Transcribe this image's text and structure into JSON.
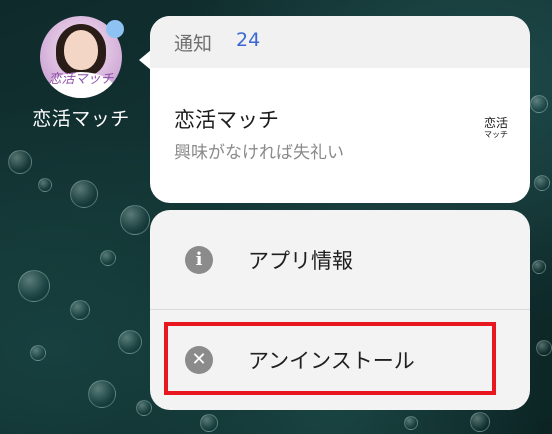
{
  "app": {
    "name": "恋活マッチ",
    "icon_name": "koikatsu-match-app-icon",
    "icon_text": "恋活マッチ",
    "badge_color": "#8ec2f2"
  },
  "notification": {
    "header_title": "通知",
    "header_count": "24",
    "title": "恋活マッチ",
    "body": "興味がなければ失礼い",
    "thumbnail_line1": "恋活",
    "thumbnail_line2": "マッチ"
  },
  "menu": {
    "items": [
      {
        "label": "アプリ情報",
        "icon": "info-icon"
      },
      {
        "label": "アンインストール",
        "icon": "uninstall-icon"
      }
    ]
  },
  "highlight": {
    "target": "uninstall",
    "color": "#e8161e"
  }
}
